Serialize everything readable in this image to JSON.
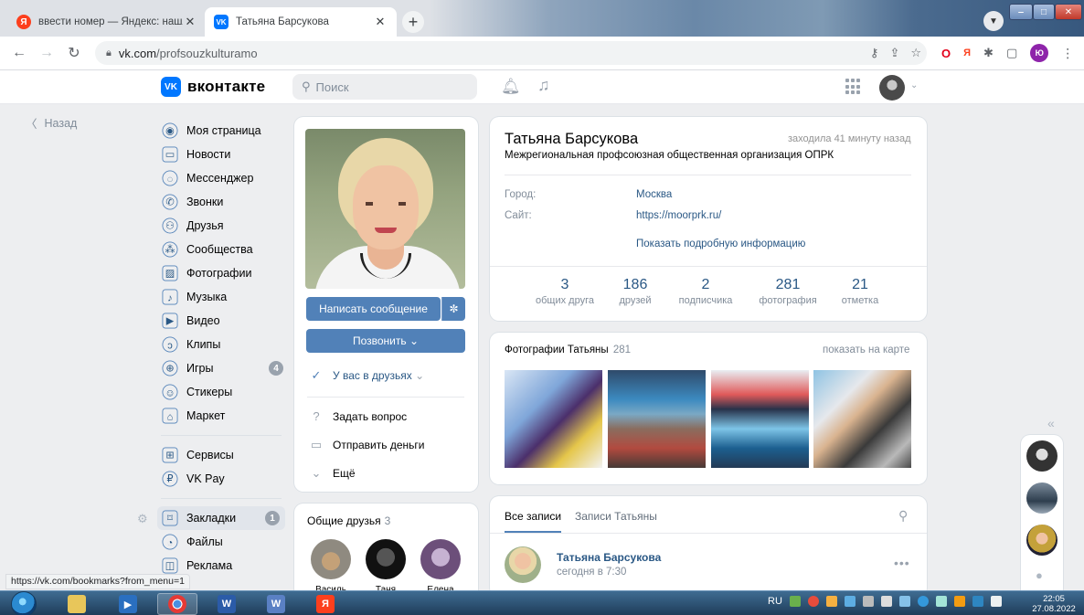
{
  "browser": {
    "tabs": [
      {
        "title": "ввести номер — Яндекс: нашлось",
        "favicon": "yandex-icon"
      },
      {
        "title": "Татьяна Барсукова",
        "favicon": "vk-icon"
      }
    ],
    "url_domain": "vk.com",
    "url_path": "/profsouzkulturamo",
    "profile_initial": "Ю",
    "status_url": "https://vk.com/bookmarks?from_menu=1"
  },
  "vk": {
    "logo_text": "вконтакте",
    "search_placeholder": "Поиск",
    "back_label": "Назад",
    "nav": [
      {
        "label": "Моя страница",
        "icon": "user-circle-icon"
      },
      {
        "label": "Новости",
        "icon": "news-icon"
      },
      {
        "label": "Мессенджер",
        "icon": "message-icon"
      },
      {
        "label": "Звонки",
        "icon": "phone-icon"
      },
      {
        "label": "Друзья",
        "icon": "friends-icon"
      },
      {
        "label": "Сообщества",
        "icon": "groups-icon"
      },
      {
        "label": "Фотографии",
        "icon": "photos-icon"
      },
      {
        "label": "Музыка",
        "icon": "music-icon"
      },
      {
        "label": "Видео",
        "icon": "video-icon"
      },
      {
        "label": "Клипы",
        "icon": "clips-icon"
      },
      {
        "label": "Игры",
        "icon": "games-icon",
        "badge": "4"
      },
      {
        "label": "Стикеры",
        "icon": "stickers-icon"
      },
      {
        "label": "Маркет",
        "icon": "market-icon"
      }
    ],
    "nav2": [
      {
        "label": "Сервисы",
        "icon": "services-icon"
      },
      {
        "label": "VK Pay",
        "icon": "vkpay-icon"
      }
    ],
    "nav3": [
      {
        "label": "Закладки",
        "icon": "bookmark-icon",
        "badge": "1"
      },
      {
        "label": "Файлы",
        "icon": "files-icon"
      },
      {
        "label": "Реклама",
        "icon": "ads-icon"
      }
    ]
  },
  "profile": {
    "name": "Татьяна Барсукова",
    "last_seen": "заходила 41 минуту назад",
    "status": "Межрегиональная профсоюзная общественная организация ОПРК",
    "info": [
      {
        "label": "Город:",
        "value": "Москва"
      },
      {
        "label": "Сайт:",
        "value": "https://moorprk.ru/"
      }
    ],
    "more_info": "Показать подробную информацию",
    "stats": [
      {
        "num": "3",
        "label": "общих друга"
      },
      {
        "num": "186",
        "label": "друзей"
      },
      {
        "num": "2",
        "label": "подписчика"
      },
      {
        "num": "281",
        "label": "фотография"
      },
      {
        "num": "21",
        "label": "отметка"
      }
    ],
    "write_message": "Написать сообщение",
    "call": "Позвонить",
    "friend_status": "У вас в друзьях",
    "ask_question": "Задать вопрос",
    "send_money": "Отправить деньги",
    "more": "Ещё",
    "mutual_friends_title": "Общие друзья",
    "mutual_friends_count": "3",
    "mutual_friends": [
      "Василь",
      "Таня",
      "Елена"
    ]
  },
  "photos": {
    "title": "Фотографии Татьяны",
    "count": "281",
    "map_link": "показать на карте"
  },
  "wall": {
    "tab_all": "Все записи",
    "tab_own": "Записи Татьяны",
    "post_author": "Татьяна Барсукова",
    "post_time": "сегодня в 7:30"
  },
  "taskbar": {
    "lang": "RU",
    "time": "22:05",
    "date": "27.08.2022"
  },
  "colors": {
    "vk_blue": "#5181b8",
    "vk_link": "#2a5885",
    "bg": "#edeef0"
  }
}
